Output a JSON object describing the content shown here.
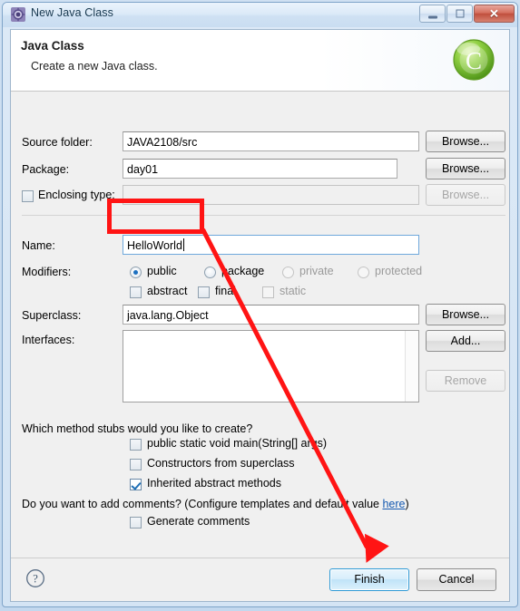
{
  "window": {
    "title": "New Java Class",
    "icon": "java-class-icon",
    "buttons": {
      "minimize": "minimize-button",
      "maximize": "maximize-button",
      "close": "✕"
    }
  },
  "header": {
    "title": "Java Class",
    "subtitle": "Create a new Java class.",
    "icon": "java-class-wizard-icon"
  },
  "form": {
    "source_folder": {
      "label": "Source folder:",
      "value": "JAVA2108/src",
      "browse": "Browse..."
    },
    "package": {
      "label": "Package:",
      "value": "day01",
      "browse": "Browse..."
    },
    "enclosing_type": {
      "label": "Enclosing type:",
      "value": "",
      "checked": false,
      "browse": "Browse...",
      "disabled": true
    },
    "name": {
      "label": "Name:",
      "value": "HelloWorld",
      "focused": true
    },
    "modifiers": {
      "label": "Modifiers:",
      "radios": [
        {
          "label": "public",
          "checked": true,
          "disabled": false
        },
        {
          "label": "package",
          "checked": false,
          "disabled": false
        },
        {
          "label": "private",
          "checked": false,
          "disabled": true
        },
        {
          "label": "protected",
          "checked": false,
          "disabled": true
        }
      ],
      "checkboxes": [
        {
          "label": "abstract",
          "checked": false,
          "disabled": false
        },
        {
          "label": "final",
          "checked": false,
          "disabled": false
        },
        {
          "label": "static",
          "checked": false,
          "disabled": true
        }
      ]
    },
    "superclass": {
      "label": "Superclass:",
      "value": "java.lang.Object",
      "browse": "Browse..."
    },
    "interfaces": {
      "label": "Interfaces:",
      "items": [],
      "add": "Add...",
      "remove": "Remove",
      "remove_disabled": true
    },
    "method_stubs": {
      "question": "Which method stubs would you like to create?",
      "options": [
        {
          "label": "public static void main(String[] args)",
          "checked": false
        },
        {
          "label": "Constructors from superclass",
          "checked": false
        },
        {
          "label": "Inherited abstract methods",
          "checked": true
        }
      ]
    },
    "comments": {
      "question_prefix": "Do you want to add comments? (Configure templates and default value ",
      "link": "here",
      "question_suffix": ")",
      "option": {
        "label": "Generate comments",
        "checked": false
      }
    }
  },
  "footer": {
    "help": "help-icon",
    "finish": "Finish",
    "cancel": "Cancel"
  },
  "annotations": {
    "highlight_box": "red-rectangle-around-name-field",
    "arrow": "red-arrow-from-name-field-to-finish-button",
    "color": "#ff1414"
  }
}
